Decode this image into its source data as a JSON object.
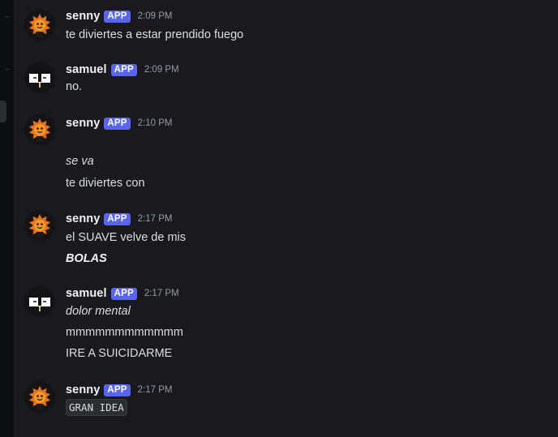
{
  "messages": [
    {
      "user": "senny",
      "badge": "APP",
      "time": "2:09 PM",
      "avatar": "sun-character-avatar",
      "lines": [
        {
          "text": "te diviertes a estar prendido fuego",
          "style": "normal"
        }
      ]
    },
    {
      "user": "samuel",
      "badge": "APP",
      "time": "2:09 PM",
      "avatar": "masked-character-avatar",
      "lines": [
        {
          "text": "no.",
          "style": "normal"
        }
      ]
    },
    {
      "user": "senny",
      "badge": "APP",
      "time": "2:10 PM",
      "avatar": "sun-character-avatar",
      "lines": [
        {
          "text": "se va",
          "style": "italic"
        },
        {
          "text": "te diviertes con",
          "style": "normal"
        }
      ]
    },
    {
      "user": "senny",
      "badge": "APP",
      "time": "2:17 PM",
      "avatar": "sun-character-avatar",
      "lines": [
        {
          "text": "el SUAVE velve de mis",
          "style": "normal"
        },
        {
          "text": "BOLAS",
          "style": "bold-italic"
        }
      ]
    },
    {
      "user": "samuel",
      "badge": "APP",
      "time": "2:17 PM",
      "avatar": "masked-character-avatar",
      "lines": [
        {
          "text": "dolor mental",
          "style": "italic"
        },
        {
          "text": "mmmmmmmmmmmm",
          "style": "normal"
        },
        {
          "text": "IRE A SUICIDARME",
          "style": "normal"
        }
      ]
    },
    {
      "user": "senny",
      "badge": "APP",
      "time": "2:17 PM",
      "avatar": "sun-character-avatar",
      "lines": [
        {
          "text": "GRAN IDEA",
          "style": "code"
        }
      ]
    }
  ],
  "colors": {
    "background": "#1a1a1e",
    "username": "#f2f3f5",
    "message_text": "#dbdee1",
    "timestamp": "#949ba4",
    "app_badge": "#5865f2"
  }
}
